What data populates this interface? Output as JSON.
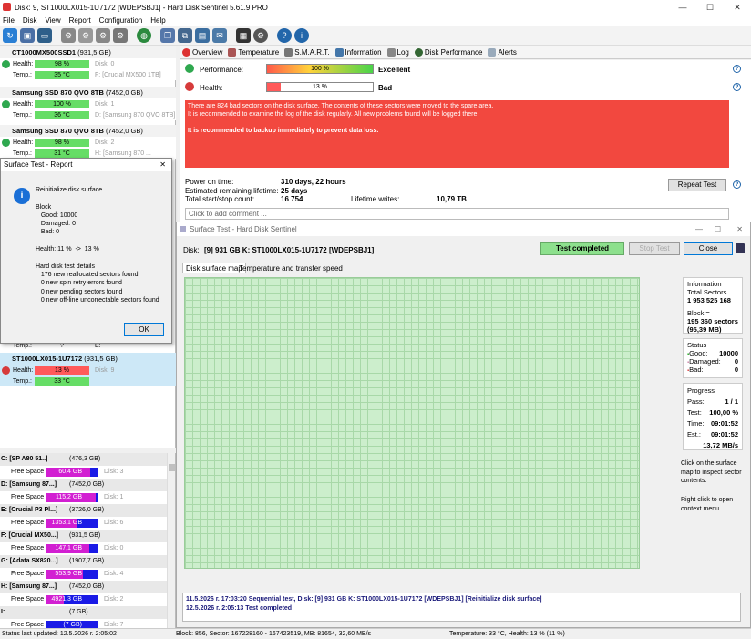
{
  "title_bar": {
    "title": "Disk: 9, ST1000LX015-1U7172 [WDEPSBJ1] - Hard Disk Sentinel 5.61.9 PRO",
    "min": "—",
    "max": "☐",
    "close": "✕"
  },
  "menu": [
    "File",
    "Disk",
    "View",
    "Report",
    "Configuration",
    "Help"
  ],
  "disks": [
    {
      "name": "CT1000MX500SSD1",
      "size": "(931,5 GB)",
      "health": "98 %",
      "temp": "35 °C",
      "right1": "Disk: 0",
      "right2": "F: [Crucial MX500 1TB]"
    },
    {
      "name": "Samsung SSD 870 QVO 8TB",
      "size": "(7452,0 GB)",
      "health": "100 %",
      "temp": "36 °C",
      "right1": "Disk: 1",
      "right2": "D: [Samsung 870 QVO 8TB]"
    },
    {
      "name": "Samsung SSD 870 QVO 8TB",
      "size": "(7452,0 GB)",
      "health": "98 %",
      "temp": "31 °C",
      "right1": "Disk: 2",
      "right2": "H: [Samsung 870 ..."
    }
  ],
  "dialog": {
    "title": "Surface Test - Report",
    "close": "✕",
    "body": "Reinitialize disk surface\n\nBlock\n   Good: 10000\n   Damaged: 0\n   Bad: 0\n\nHealth: 11 %  ->  13 %\n\nHard disk test details\n   176 new reallocated sectors found\n   0 new spin retry errors found\n   0 new pending sectors found\n   0 new off-line uncorrectable sectors found",
    "ok": "OK",
    "icon_glyph": "i"
  },
  "hidden_temp": {
    "label": "Temp.:",
    "value": "?",
    "right": "E:"
  },
  "selected_disk": {
    "name": "ST1000LX015-1U7172",
    "size": "(931,5 GB)",
    "health_label": "Health:",
    "health": "13 %",
    "temp_label": "Temp.:",
    "temp": "33 °C",
    "right1": "Disk: 9"
  },
  "labels": {
    "health": "Health:",
    "temp": "Temp.:",
    "free": "Free Space"
  },
  "partitions": [
    {
      "name": "C: [SP A80 51..]",
      "size": "(476,3 GB)",
      "free": "60,4 GB",
      "disk": "Disk: 3",
      "used": 0.85
    },
    {
      "name": "D: [Samsung 87...]",
      "size": "(7452,0 GB)",
      "free": "115,2 GB",
      "disk": "Disk: 1",
      "used": 0.95
    },
    {
      "name": "E: [Crucial P3 Pl...]",
      "size": "(3726,0 GB)",
      "free": "1353,1 GB",
      "disk": "Disk: 6",
      "used": 0.6
    },
    {
      "name": "F: [Crucial MX50...]",
      "size": "(931,5 GB)",
      "free": "147,1 GB",
      "disk": "Disk: 0",
      "used": 0.82
    },
    {
      "name": "G: [Adata SX820...]",
      "size": "(1907,7 GB)",
      "free": "553,9 GB",
      "disk": "Disk: 4",
      "used": 0.7
    },
    {
      "name": "H: [Samsung 87...]",
      "size": "(7452,0 GB)",
      "free": "4921,3 GB",
      "disk": "Disk: 2",
      "used": 0.35
    },
    {
      "name": "I:",
      "size": "(7 GB)",
      "free": "(7 GB)",
      "disk": "Disk: 7",
      "used": 0.0
    }
  ],
  "status_left": "Status last updated: 12.5.2026 г. 2:05:02",
  "tabs": [
    "Overview",
    "Temperature",
    "S.M.A.R.T.",
    "Information",
    "Log",
    "Disk Performance",
    "Alerts"
  ],
  "overview": {
    "perf_label": "Performance:",
    "perf_value": "100 %",
    "perf_word": "Excellent",
    "health_label": "Health:",
    "health_value": "13 %",
    "health_word": "Bad",
    "alert_lines": [
      "There are 824 bad sectors on the disk surface. The contents of these sectors were moved to the spare area.",
      "It is recommended to examine the log of the disk regularly. All new problems found will be logged there."
    ],
    "alert_bold": "It is recommended to backup immediately to prevent data loss.",
    "power_on_label": "Power on time:",
    "power_on": "310 days, 22 hours",
    "remaining_label": "Estimated remaining lifetime:",
    "remaining": "25 days",
    "startstop_label": "Total start/stop count:",
    "startstop": "16 754",
    "writes_label": "Lifetime writes:",
    "writes": "10,79 TB",
    "repeat": "Repeat Test",
    "comment_placeholder": "Click to add comment ...",
    "perf_fill": 1.0,
    "health_fill": 0.13
  },
  "surface": {
    "title": "Surface Test - Hard Disk Sentinel",
    "disk_label": "Disk:",
    "disk": "[9] 931 GB K: ST1000LX015-1U7172 [WDEPSBJ1]",
    "status": "Test completed",
    "stop": "Stop Test",
    "close": "Close",
    "tab_map": "Disk surface map",
    "tab_temp": "Temperature and transfer speed",
    "info_title": "Information",
    "total_label": "Total Sectors",
    "total": "1 953 525 168",
    "block_label": "Block =",
    "block": "195 360 sectors",
    "block_mb": "(95,39 MB)",
    "status_title": "Status",
    "good_label": "Good:",
    "good": "10000",
    "damaged_label": "Damaged:",
    "damaged": "0",
    "bad_label": "Bad:",
    "bad": "0",
    "progress_title": "Progress",
    "pass_label": "Pass:",
    "pass": "1 / 1",
    "test_label": "Test:",
    "test": "100,00 %",
    "time_label": "Time:",
    "time": "09:01:52",
    "est_label": "Est.:",
    "est": "09:01:52",
    "speed": "13,72 MB/s",
    "hint1": "Click on the surface map to inspect sector contents.",
    "hint2": "Right click to open context menu.",
    "log1": "11.5.2026 г.  17:03:20   Sequential test, Disk: [9] 931 GB K: ST1000LX015-1U7172 [WDEPSBJ1] [Reinitialize disk surface]",
    "log2": "12.5.2026 г.   2:05:13   Test completed",
    "status_bar_left": "Block: 856, Sector: 167228160 - 167423519, MB: 81654, 32,60 MB/s",
    "status_bar_right": "Temperature: 33  °C,  Health: 13 % (11 %)"
  },
  "colors": {
    "accent": "#0078d7",
    "good": "#66dd66",
    "bad": "#f2483f",
    "alert": "#f2483f"
  }
}
